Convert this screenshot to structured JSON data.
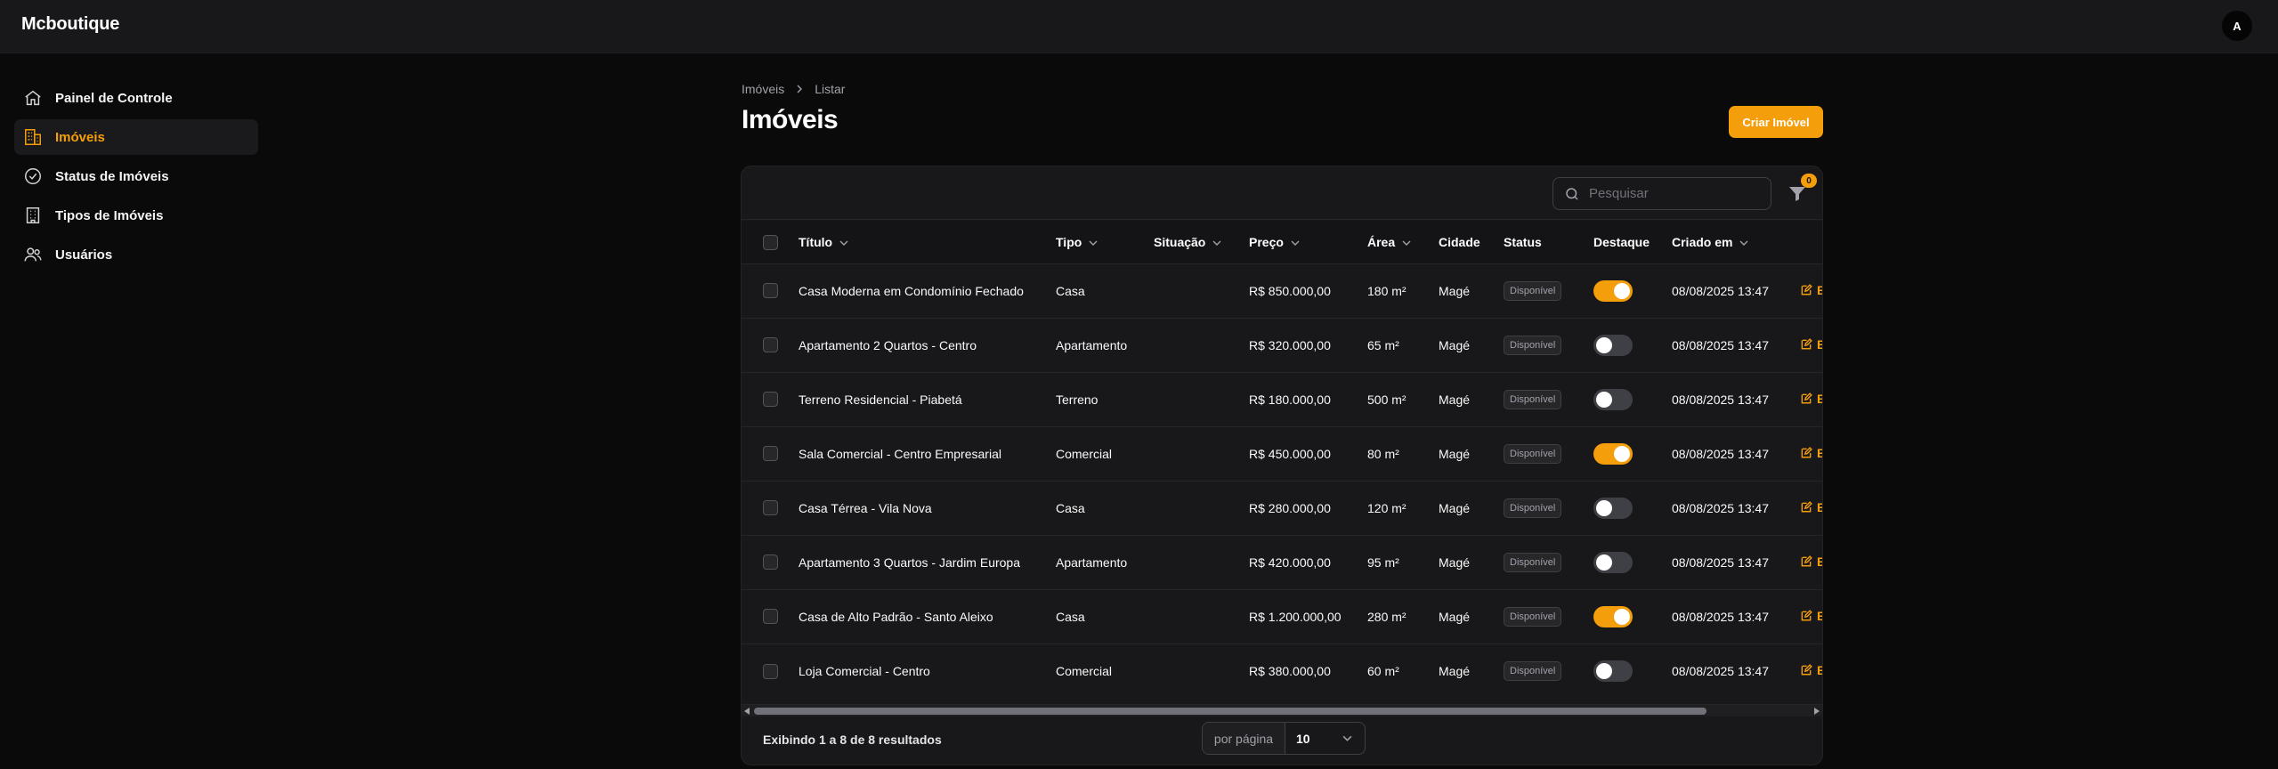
{
  "app": {
    "name": "Mcboutique",
    "avatar_initial": "A"
  },
  "colors": {
    "accent": "#f59e0b",
    "background": "#0a0a0a",
    "surface": "#18181b"
  },
  "sidebar": {
    "items": [
      {
        "label": "Painel de Controle",
        "icon": "home-icon",
        "active": false
      },
      {
        "label": "Imóveis",
        "icon": "building-icon",
        "active": true
      },
      {
        "label": "Status de Imóveis",
        "icon": "check-circle-icon",
        "active": false
      },
      {
        "label": "Tipos de Imóveis",
        "icon": "office-building-icon",
        "active": false
      },
      {
        "label": "Usuários",
        "icon": "users-icon",
        "active": false
      }
    ]
  },
  "breadcrumb": {
    "items": [
      "Imóveis",
      "Listar"
    ]
  },
  "header": {
    "title": "Imóveis",
    "create_label": "Criar Imóvel"
  },
  "search": {
    "placeholder": "Pesquisar",
    "value": ""
  },
  "filters": {
    "active_count": "0"
  },
  "table": {
    "columns": [
      "Título",
      "Tipo",
      "Situação",
      "Preço",
      "Área",
      "Cidade",
      "Status",
      "Destaque",
      "Criado em"
    ],
    "edit_label": "Editar",
    "rows": [
      {
        "titulo": "Casa Moderna em Condomínio Fechado",
        "tipo": "Casa",
        "situacao": "",
        "preco": "R$ 850.000,00",
        "area": "180 m²",
        "cidade": "Magé",
        "status": "Disponível",
        "destaque": true,
        "criado": "08/08/2025 13:47"
      },
      {
        "titulo": "Apartamento 2 Quartos - Centro",
        "tipo": "Apartamento",
        "situacao": "",
        "preco": "R$ 320.000,00",
        "area": "65 m²",
        "cidade": "Magé",
        "status": "Disponível",
        "destaque": false,
        "criado": "08/08/2025 13:47"
      },
      {
        "titulo": "Terreno Residencial - Piabetá",
        "tipo": "Terreno",
        "situacao": "",
        "preco": "R$ 180.000,00",
        "area": "500 m²",
        "cidade": "Magé",
        "status": "Disponível",
        "destaque": false,
        "criado": "08/08/2025 13:47"
      },
      {
        "titulo": "Sala Comercial - Centro Empresarial",
        "tipo": "Comercial",
        "situacao": "",
        "preco": "R$ 450.000,00",
        "area": "80 m²",
        "cidade": "Magé",
        "status": "Disponível",
        "destaque": true,
        "criado": "08/08/2025 13:47"
      },
      {
        "titulo": "Casa Térrea - Vila Nova",
        "tipo": "Casa",
        "situacao": "",
        "preco": "R$ 280.000,00",
        "area": "120 m²",
        "cidade": "Magé",
        "status": "Disponível",
        "destaque": false,
        "criado": "08/08/2025 13:47"
      },
      {
        "titulo": "Apartamento 3 Quartos - Jardim Europa",
        "tipo": "Apartamento",
        "situacao": "",
        "preco": "R$ 420.000,00",
        "area": "95 m²",
        "cidade": "Magé",
        "status": "Disponível",
        "destaque": false,
        "criado": "08/08/2025 13:47"
      },
      {
        "titulo": "Casa de Alto Padrão - Santo Aleixo",
        "tipo": "Casa",
        "situacao": "",
        "preco": "R$ 1.200.000,00",
        "area": "280 m²",
        "cidade": "Magé",
        "status": "Disponível",
        "destaque": true,
        "criado": "08/08/2025 13:47"
      },
      {
        "titulo": "Loja Comercial - Centro",
        "tipo": "Comercial",
        "situacao": "",
        "preco": "R$ 380.000,00",
        "area": "60 m²",
        "cidade": "Magé",
        "status": "Disponível",
        "destaque": false,
        "criado": "08/08/2025 13:47"
      }
    ]
  },
  "pagination": {
    "summary": "Exibindo 1 a 8 de 8 resultados",
    "per_page_label": "por página",
    "per_page_value": "10"
  }
}
